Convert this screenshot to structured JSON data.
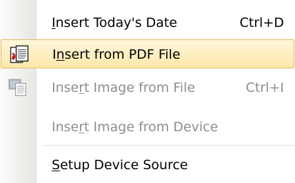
{
  "menu": {
    "items": [
      {
        "label_pre": "",
        "label_accel": "I",
        "label_post": "nsert Today's Date",
        "shortcut": "Ctrl+D",
        "enabled": true,
        "icon": ""
      },
      {
        "label_pre": "I",
        "label_accel": "n",
        "label_post": "sert from PDF File",
        "shortcut": "",
        "enabled": true,
        "icon": "pdf-document-icon",
        "highlighted": true
      },
      {
        "label_pre": "Inse",
        "label_accel": "r",
        "label_post": "t Image from File",
        "shortcut": "Ctrl+I",
        "enabled": false,
        "icon": "image-file-icon"
      },
      {
        "label_pre": "Inse",
        "label_accel": "r",
        "label_post": "t Image from Device",
        "shortcut": "",
        "enabled": false,
        "icon": ""
      },
      {
        "label_pre": "",
        "label_accel": "S",
        "label_post": "etup Device Source",
        "shortcut": "",
        "enabled": true,
        "icon": ""
      }
    ]
  },
  "colors": {
    "highlight_top": "#fff7dc",
    "highlight_bottom": "#fde7a9",
    "highlight_border": "#e2b75d",
    "disabled_text": "#8d8d8d",
    "gutter": "#ebe9e4"
  }
}
